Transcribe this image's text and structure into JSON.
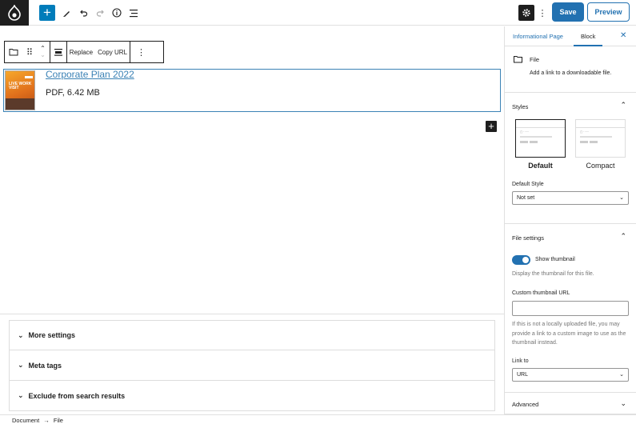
{
  "topbar": {
    "save_label": "Save",
    "preview_label": "Preview"
  },
  "block_toolbar": {
    "replace_label": "Replace",
    "copy_url_label": "Copy URL"
  },
  "file_block": {
    "file_name": "Corporate Plan 2022",
    "file_meta": "PDF, 6.42 MB",
    "thumbnail_text": "LIVE WORK VISIT"
  },
  "meta_panels": [
    {
      "label": "More settings"
    },
    {
      "label": "Meta tags"
    },
    {
      "label": "Exclude from search results"
    }
  ],
  "footer": {
    "crumb_1": "Document",
    "separator": "→",
    "crumb_2": "File"
  },
  "sidebar": {
    "tabs": {
      "page": "Informational Page",
      "block": "Block"
    },
    "block_card": {
      "title": "File",
      "description": "Add a link to a downloadable file."
    },
    "styles": {
      "title": "Styles",
      "options": [
        "Default",
        "Compact"
      ],
      "default_style_label": "Default Style",
      "default_style_value": "Not set"
    },
    "file_settings": {
      "title": "File settings",
      "toggle_label": "Show thumbnail",
      "toggle_on": true,
      "toggle_help": "Display the thumbnail for this file.",
      "custom_url_label": "Custom thumbnail URL",
      "custom_url_value": "",
      "custom_url_help": "If this is not a locally uploaded file, you may provide a link to a custom image to use as the thumbnail instead.",
      "link_to_label": "Link to",
      "link_to_value": "URL"
    },
    "advanced": {
      "title": "Advanced"
    }
  },
  "colors": {
    "accent": "#2271b1",
    "block_border": "#3b82b5",
    "dark": "#1e1e1e"
  }
}
